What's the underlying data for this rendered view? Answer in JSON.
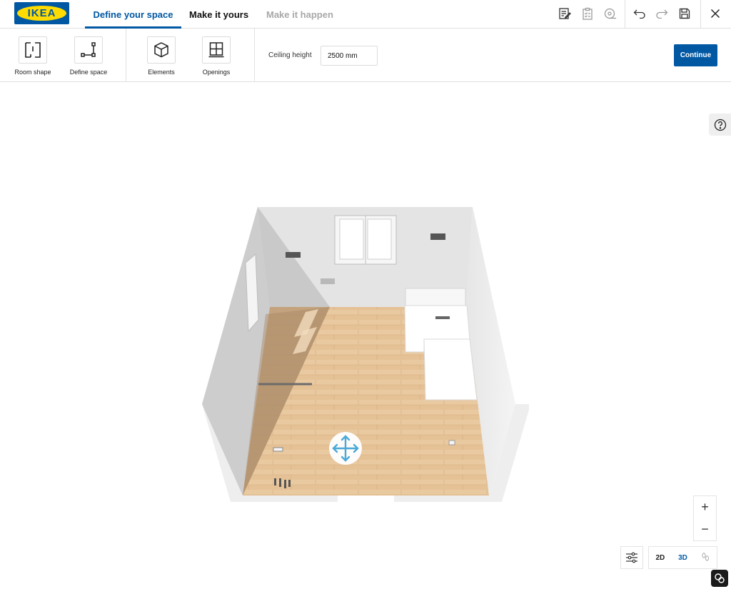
{
  "header": {
    "logo_text": "IKEA",
    "stages": [
      {
        "label": "Define your space",
        "state": "active"
      },
      {
        "label": "Make it yours",
        "state": "enabled"
      },
      {
        "label": "Make it happen",
        "state": "disabled"
      }
    ],
    "icons": [
      "notes-icon",
      "checklist-icon",
      "measure-tape-icon",
      "undo-icon",
      "redo-icon",
      "save-icon",
      "close-icon"
    ]
  },
  "toolbar": {
    "tools": [
      {
        "label": "Room shape",
        "icon": "room-shape-icon"
      },
      {
        "label": "Define space",
        "icon": "define-space-icon"
      },
      {
        "label": "Elements",
        "icon": "cube-icon"
      },
      {
        "label": "Openings",
        "icon": "window-icon"
      }
    ],
    "ceiling_label": "Ceiling height",
    "ceiling_value": "2500 mm",
    "continue_label": "Continue"
  },
  "viewer": {
    "help_icon": "question-icon",
    "zoom_in": "+",
    "zoom_out": "−",
    "view_2d": "2D",
    "view_3d": "3D",
    "active_view": "3D",
    "walk_icon": "footprints-icon",
    "settings_icon": "sliders-icon",
    "chat_icon": "chat-icon"
  },
  "colors": {
    "brand_blue": "#0058a3",
    "brand_yellow": "#ffdb00",
    "floor_wood": "#e0b98e",
    "wall_grey": "#d4d4d4",
    "move_handle": "#4aa8d8"
  }
}
